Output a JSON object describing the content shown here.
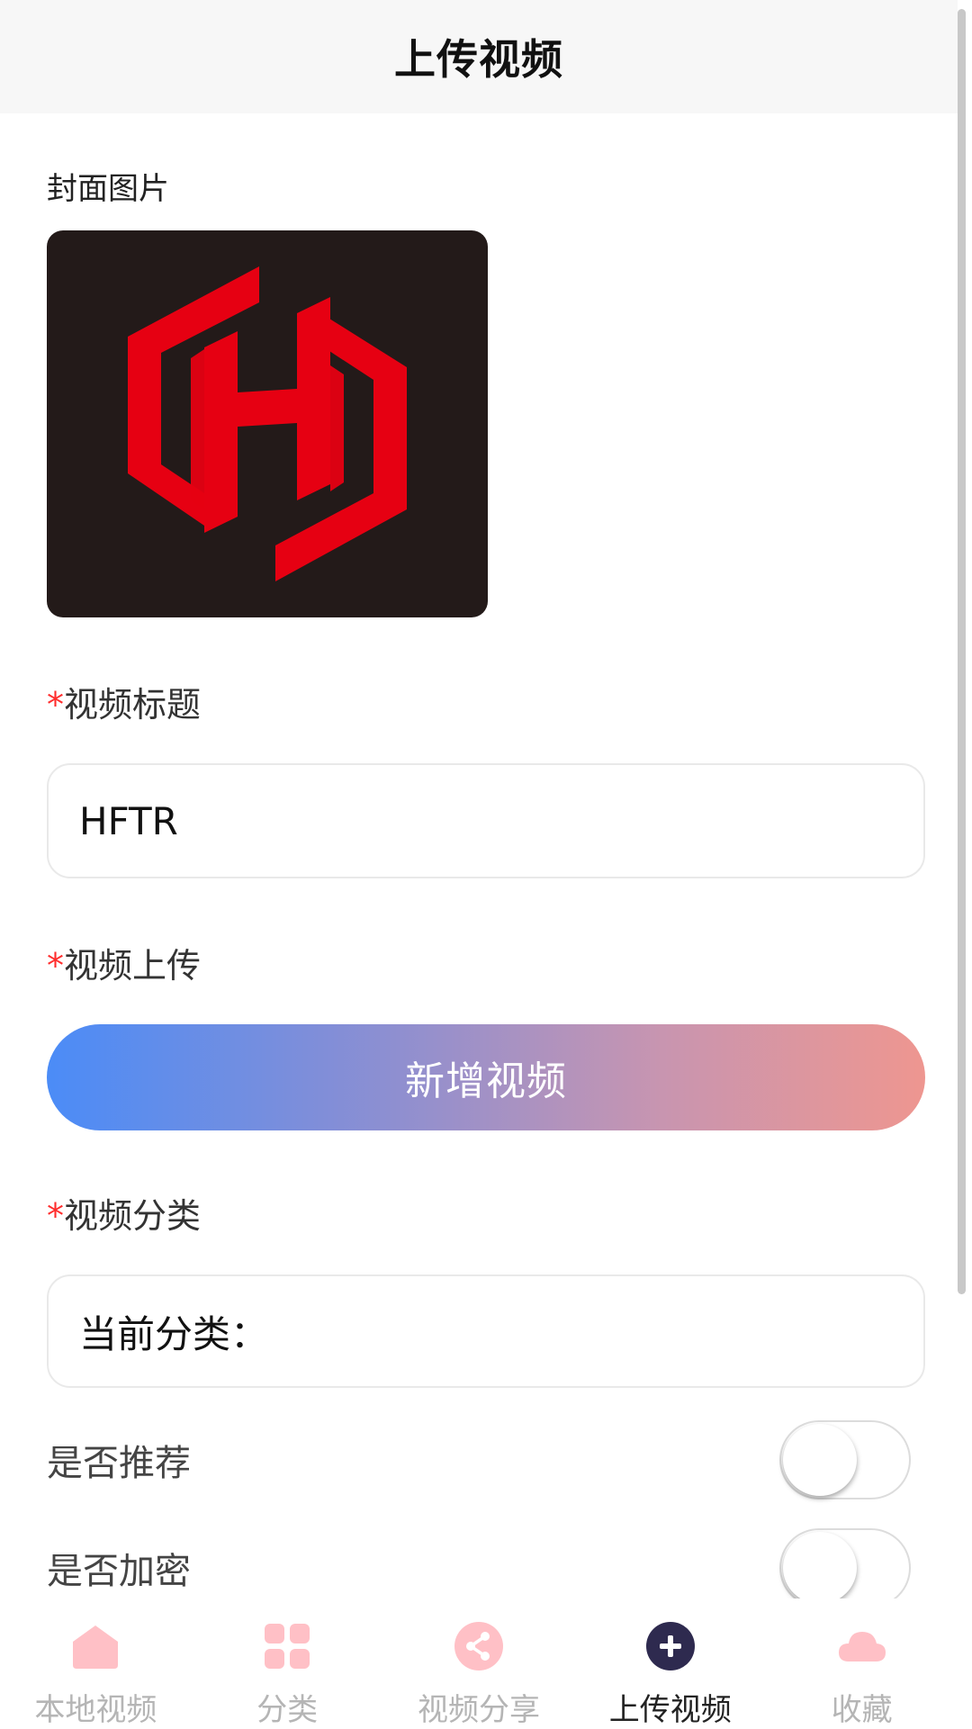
{
  "header": {
    "title": "上传视频"
  },
  "form": {
    "cover_label": "封面图片",
    "required_mark": "*",
    "title_label": "视频标题",
    "title_value": "HFTR",
    "upload_label": "视频上传",
    "upload_button": "新增视频",
    "category_label": "视频分类",
    "category_value": "当前分类：",
    "recommend_label": "是否推荐",
    "recommend_on": false,
    "encrypt_label": "是否加密",
    "encrypt_on": false
  },
  "colors": {
    "required": "#ff2d2d",
    "tab_inactive": "#ffc0c6",
    "tab_active": "#2e2a4f",
    "cover_bg": "#231a19",
    "logo_red": "#e60012",
    "button_gradient_start": "#4b8cf7",
    "button_gradient_end": "#ee9690"
  },
  "tabbar": {
    "items": [
      {
        "label": "本地视频",
        "icon": "home-icon",
        "active": false
      },
      {
        "label": "分类",
        "icon": "grid-icon",
        "active": false
      },
      {
        "label": "视频分享",
        "icon": "share-icon",
        "active": false
      },
      {
        "label": "上传视频",
        "icon": "plus-circle-icon",
        "active": true
      },
      {
        "label": "收藏",
        "icon": "cloud-icon",
        "active": false
      }
    ]
  }
}
